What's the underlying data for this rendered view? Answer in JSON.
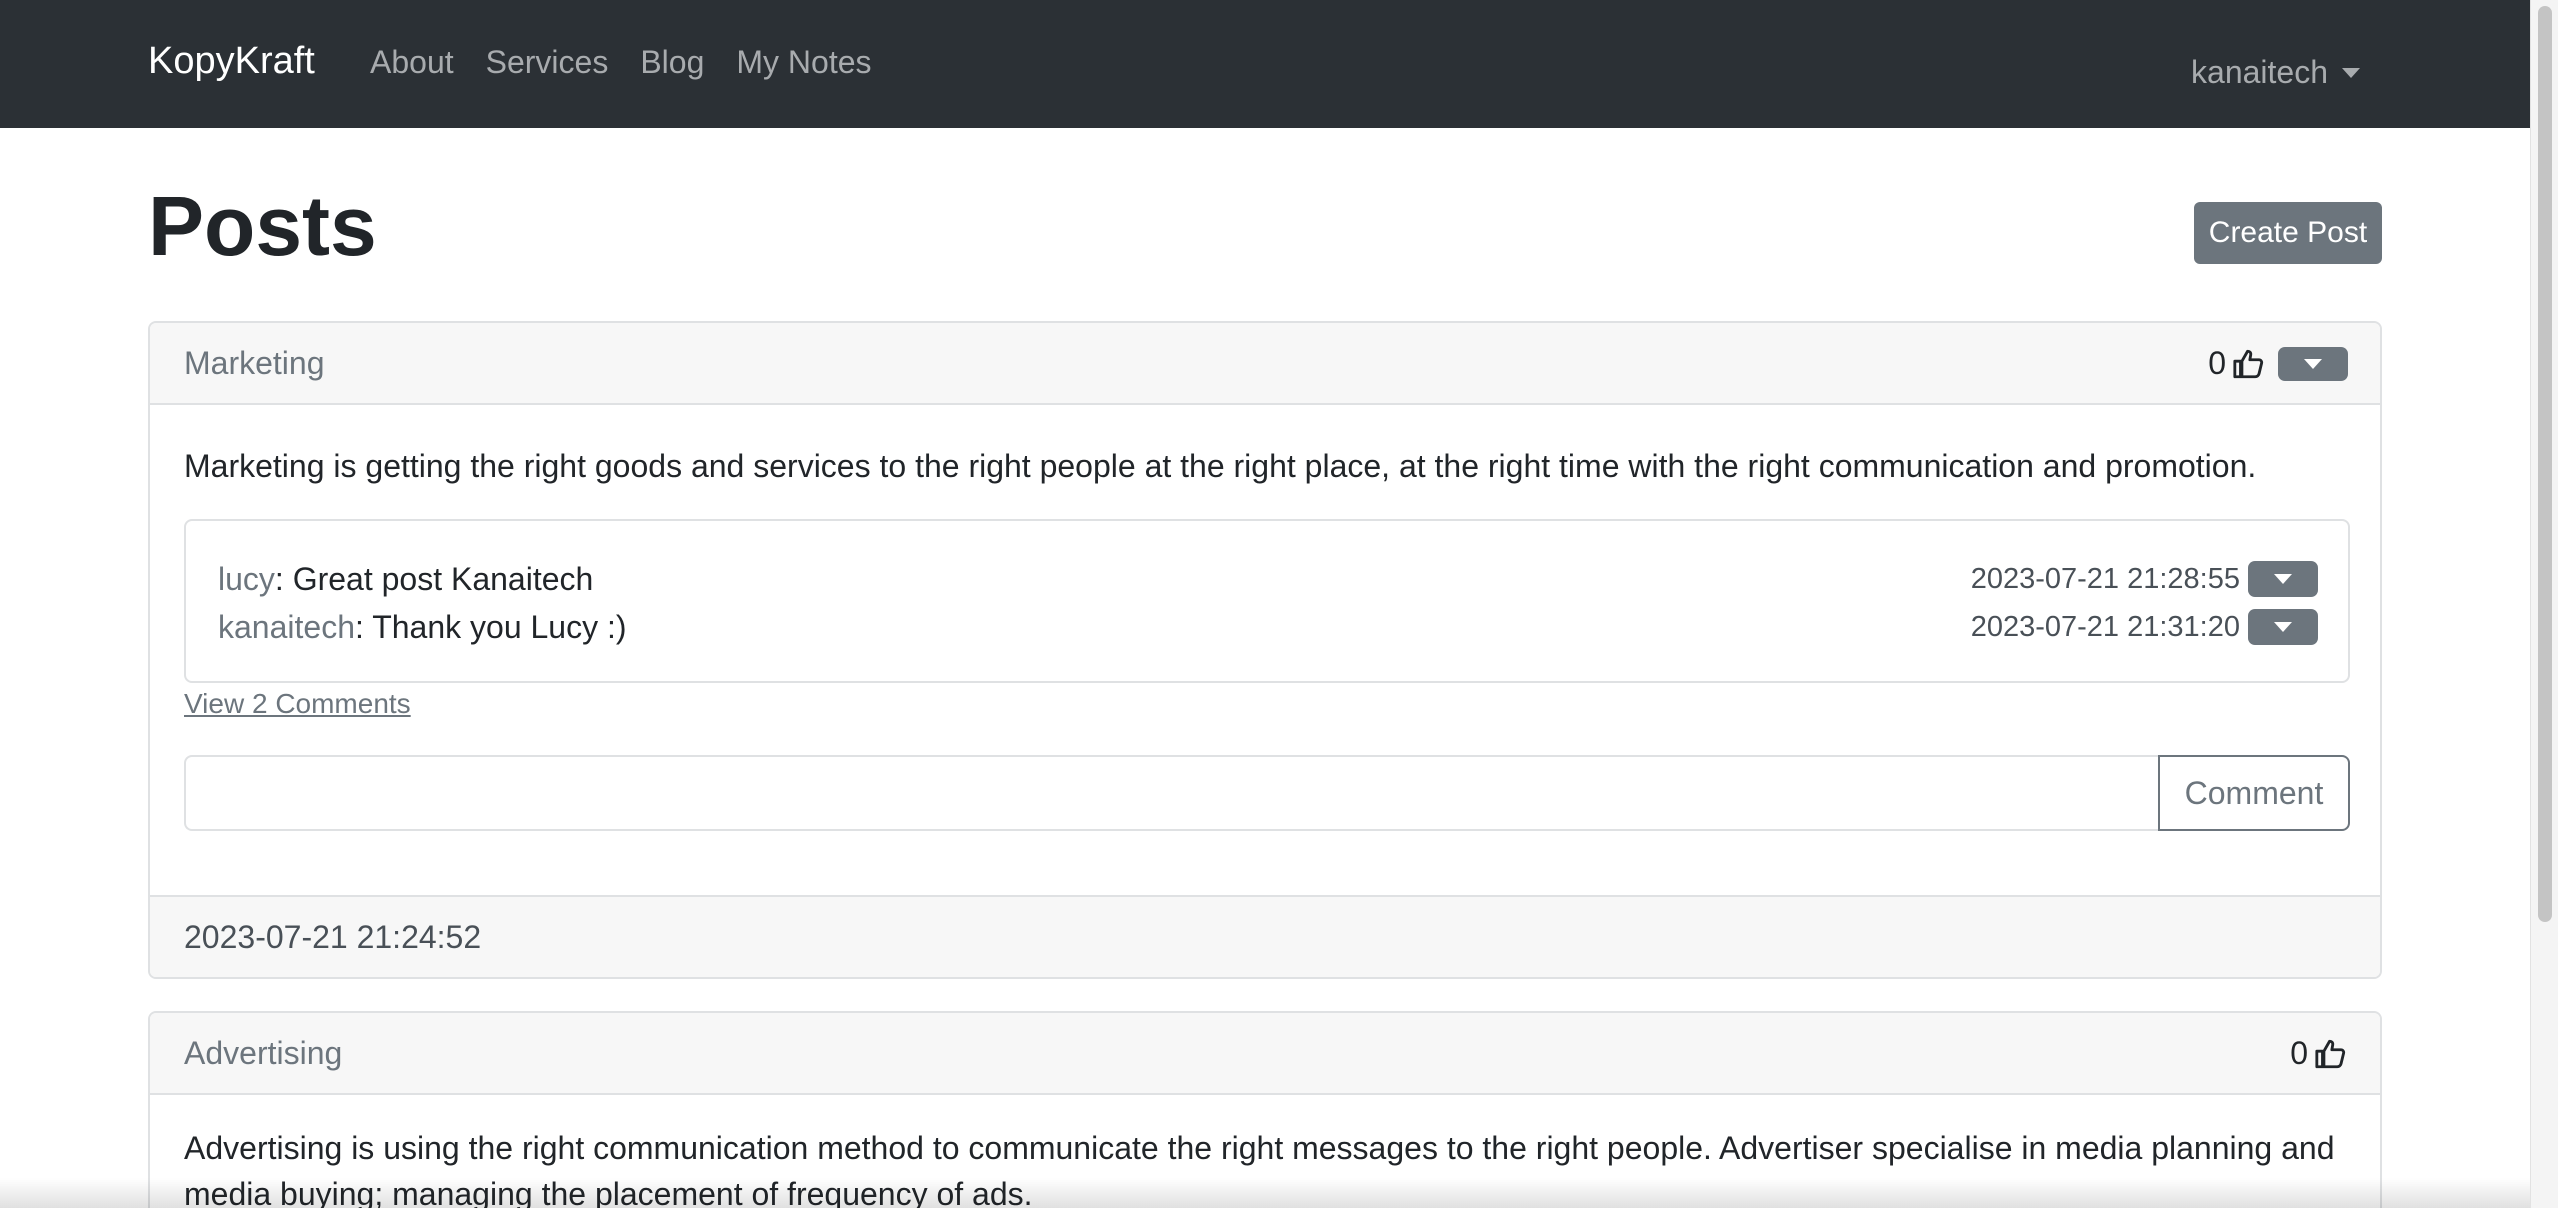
{
  "navbar": {
    "brand": "KopyKraft",
    "links": [
      "About",
      "Services",
      "Blog",
      "My Notes"
    ],
    "user": "kanaitech"
  },
  "page": {
    "title": "Posts",
    "create_button": "Create Post"
  },
  "posts": [
    {
      "title": "Marketing",
      "likes": "0",
      "body": "Marketing is getting the right goods and services to the right people at the right place, at the right time with the right communication and promotion.",
      "comments": [
        {
          "user": "lucy",
          "text": ": Great post Kanaitech",
          "time": "2023-07-21 21:28:55"
        },
        {
          "user": "kanaitech",
          "text": ": Thank you Lucy :)",
          "time": "2023-07-21 21:31:20"
        }
      ],
      "view_comments": "View 2 Comments",
      "comment_input_value": "",
      "comment_button": "Comment",
      "date": "2023-07-21 21:24:52"
    },
    {
      "title": "Advertising",
      "likes": "0",
      "body": "Advertising is using the right communication method to communicate the right messages to the right people. Advertiser specialise in media planning and media buying; managing the placement of frequency of ads."
    }
  ],
  "icons": {
    "like": "thumbs-up-icon",
    "dropdown": "caret-down-icon"
  },
  "colors": {
    "navbar_bg": "#2b3035",
    "secondary": "#6c757d"
  }
}
